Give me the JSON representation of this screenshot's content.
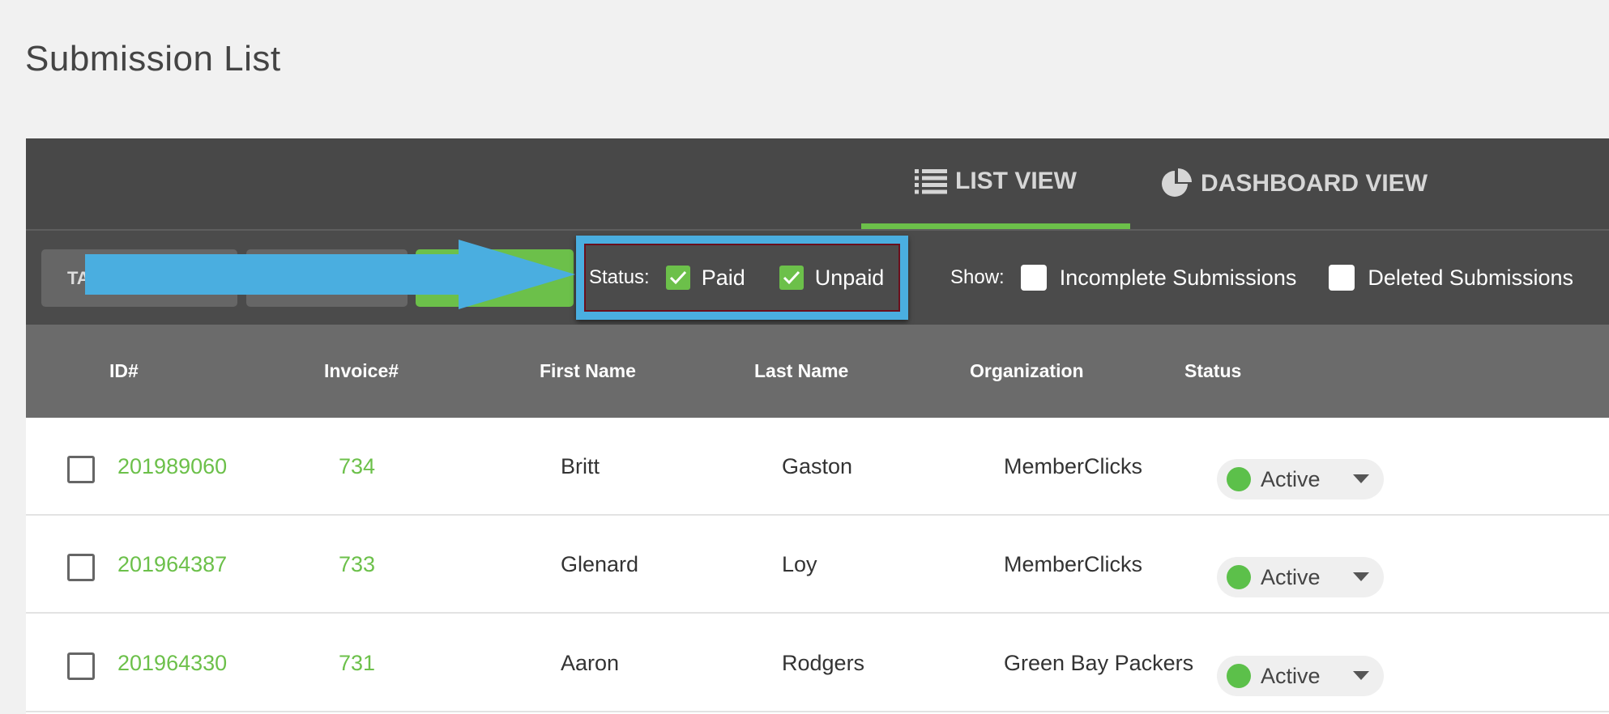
{
  "page": {
    "title": "Submission List"
  },
  "views": {
    "list_label": "LIST VIEW",
    "dashboard_label": "DASHBOARD VIEW"
  },
  "toolbar": {
    "first_button_partial": "TA"
  },
  "filters": {
    "status_label": "Status:",
    "paid_label": "Paid",
    "paid_checked": true,
    "unpaid_label": "Unpaid",
    "unpaid_checked": true,
    "show_label": "Show:",
    "incomplete_label": "Incomplete Submissions",
    "incomplete_checked": false,
    "deleted_label": "Deleted Submissions",
    "deleted_checked": false
  },
  "table": {
    "columns": [
      "ID#",
      "Invoice#",
      "First Name",
      "Last Name",
      "Organization",
      "Status"
    ],
    "rows": [
      {
        "id": "201989060",
        "invoice": "734",
        "first": "Britt",
        "last": "Gaston",
        "org": "MemberClicks",
        "status": "Active"
      },
      {
        "id": "201964387",
        "invoice": "733",
        "first": "Glenard",
        "last": "Loy",
        "org": "MemberClicks",
        "status": "Active"
      },
      {
        "id": "201964330",
        "invoice": "731",
        "first": "Aaron",
        "last": "Rodgers",
        "org": "Green Bay Packers",
        "status": "Active"
      }
    ]
  },
  "colors": {
    "accent_green": "#6cc04a",
    "highlight_blue": "#4aaee0",
    "header_dark": "#484848",
    "table_header": "#6b6b6b"
  }
}
